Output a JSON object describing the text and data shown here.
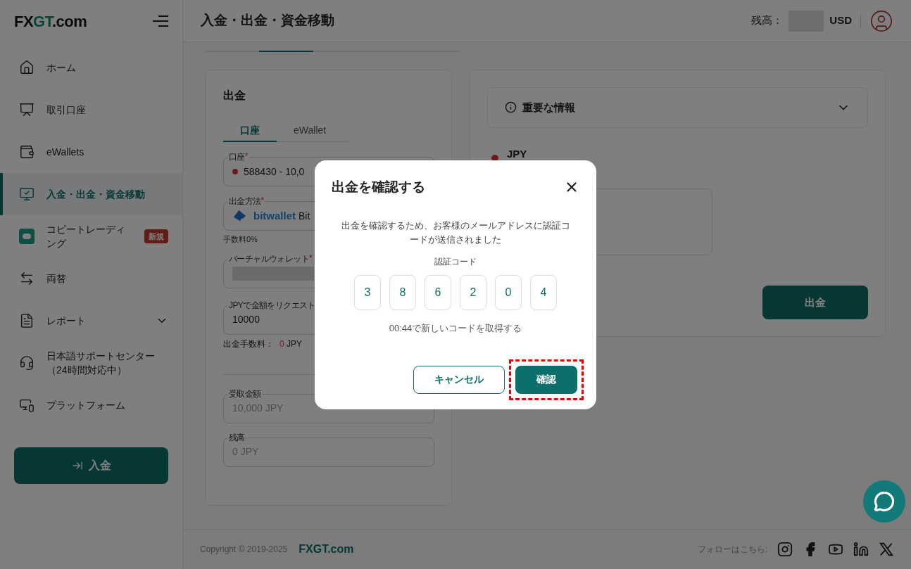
{
  "logo": [
    {
      "text": "FX",
      "kind": "dark"
    },
    {
      "text": "GT",
      "kind": "accent"
    },
    {
      "text": ".com",
      "kind": "dark"
    }
  ],
  "sidebar": {
    "items": [
      {
        "label": "ホーム",
        "selected": false
      },
      {
        "label": "取引口座",
        "selected": false
      },
      {
        "label": "eWallets",
        "selected": false
      },
      {
        "label": "入金・出金・資金移動",
        "selected": true
      },
      {
        "label": "コピートレーディング",
        "selected": false,
        "badge": "新規"
      },
      {
        "label": "両替",
        "selected": false
      },
      {
        "label": "レポート",
        "selected": false,
        "expanded": false
      },
      {
        "label": "日本語サポートセンター（24時間対応中）",
        "selected": false
      },
      {
        "label": "プラットフォーム",
        "selected": false
      }
    ],
    "deposit_button": "入金"
  },
  "header": {
    "title": "入金・出金・資金移動",
    "balance_label": "残高：",
    "balance_hidden": true,
    "currency": "USD"
  },
  "withdraw_card": {
    "title": "出金",
    "required_mark": "*",
    "tabs": [
      {
        "label": "口座",
        "selected": true
      },
      {
        "label": "eWallet",
        "selected": false
      }
    ],
    "account": {
      "label": "口座",
      "required": true,
      "value": "588430 - 10,0"
    },
    "method": {
      "label": "出金方法",
      "required": true,
      "logo_text": "bitwallet",
      "value": "Bit"
    },
    "fee_note": "手数料0%",
    "wallet": {
      "label": "バーチャルウォレット",
      "required": true,
      "value_hidden": true
    },
    "amount": {
      "label": "JPYで金額をリクエスト",
      "value": "10000"
    },
    "withdraw_fee": {
      "label": "出金手数料：",
      "amount": "0",
      "unit": "JPY"
    },
    "received": {
      "label": "受取金額",
      "value": "10,000 JPY"
    },
    "balance": {
      "label": "残高",
      "value": "0 JPY"
    }
  },
  "info_card": {
    "accordion": {
      "title": "重要な情報",
      "expanded": false
    },
    "currency": "JPY",
    "submit_button": "出金"
  },
  "modal": {
    "title": "出金を確認する",
    "message": "出金を確認するため、お客様のメールアドレスに認証コードが送信されました",
    "code_label": "認証コード",
    "code": [
      "3",
      "8",
      "6",
      "2",
      "0",
      "4"
    ],
    "resend": "00:44で新しいコードを取得する",
    "cancel_button": "キャンセル",
    "confirm_button": {
      "label": "確認",
      "highlighted": true
    }
  },
  "footer": {
    "copyright": "Copyright © 2019-2025",
    "brand": "FXGT.com",
    "follow_label": "フォローはこちら:",
    "social": [
      {
        "kind": "instagram"
      },
      {
        "kind": "facebook"
      },
      {
        "kind": "youtube"
      },
      {
        "kind": "linkedin"
      },
      {
        "kind": "x"
      }
    ]
  }
}
